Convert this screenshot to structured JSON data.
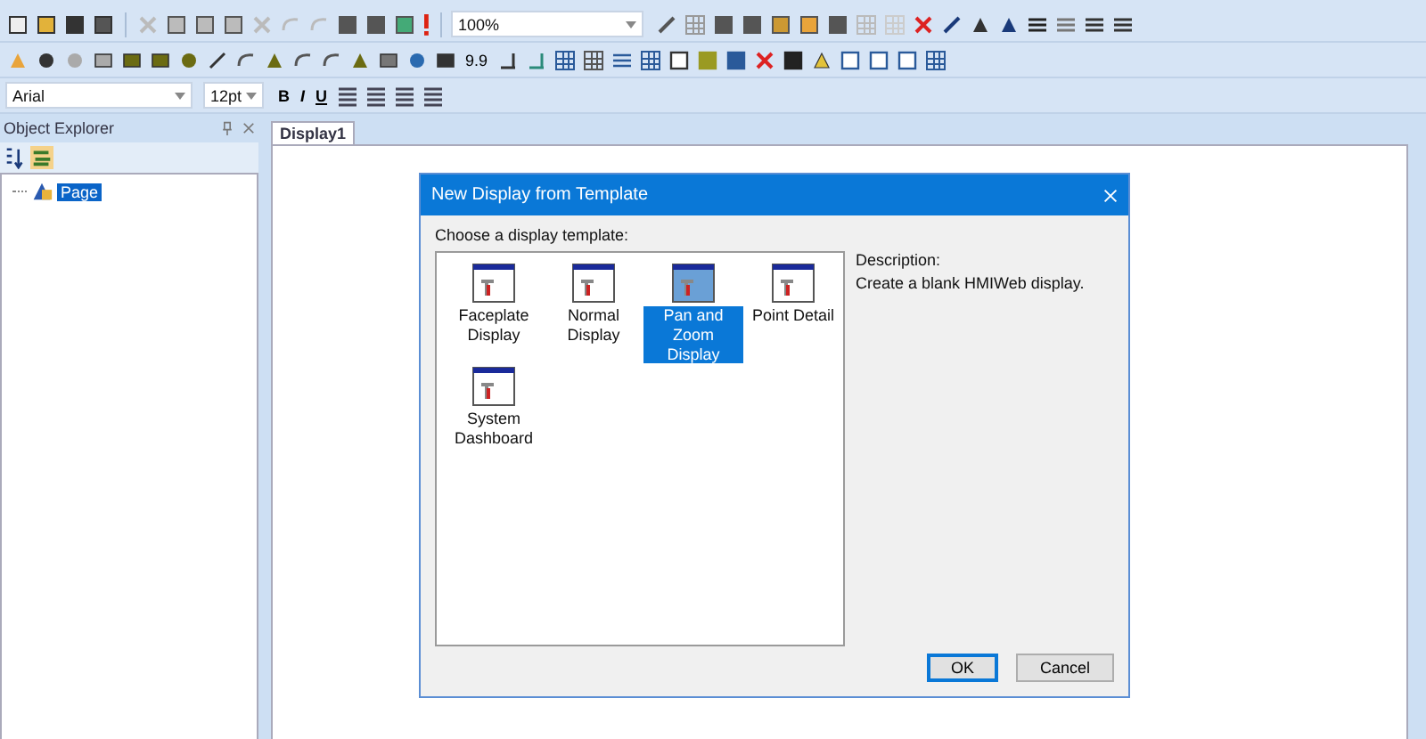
{
  "toolbar": {
    "zoom": "100%",
    "font": "Arial",
    "size": "12pt",
    "value_format": "9.9",
    "bold": "B",
    "italic": "I",
    "underline": "U"
  },
  "object_explorer": {
    "title": "Object Explorer",
    "tree": [
      {
        "label": "Page",
        "selected": true
      }
    ]
  },
  "tabs": [
    {
      "label": "Display1",
      "selected": true
    }
  ],
  "dialog": {
    "title": "New Display from Template",
    "prompt": "Choose a display template:",
    "templates": [
      {
        "label": "Faceplate Display",
        "selected": false
      },
      {
        "label": "Normal Display",
        "selected": false
      },
      {
        "label": "Pan and Zoom Display",
        "selected": true
      },
      {
        "label": "Point Detail",
        "selected": false
      },
      {
        "label": "System Dashboard",
        "selected": false
      }
    ],
    "description_label": "Description:",
    "description": "Create a blank HMIWeb display.",
    "buttons": [
      {
        "label": "OK",
        "default": true
      },
      {
        "label": "Cancel",
        "default": false
      }
    ]
  }
}
